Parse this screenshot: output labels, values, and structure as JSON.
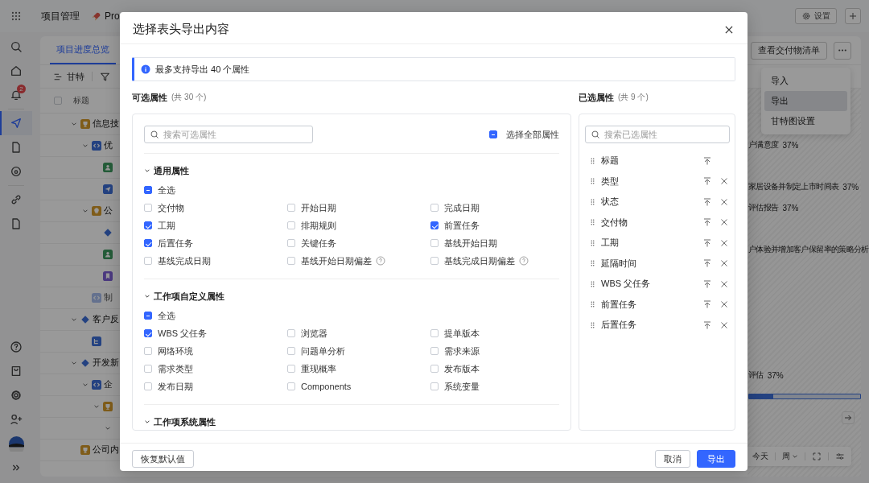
{
  "app": {
    "title": "项目管理",
    "project": "Pro",
    "settings": "设置",
    "sidebar_top": [
      {
        "kind": "search",
        "selected": false
      },
      {
        "kind": "home",
        "selected": false
      },
      {
        "kind": "bell",
        "selected": false,
        "badge": "2"
      },
      {
        "kind": "send",
        "selected": true
      },
      {
        "kind": "file",
        "selected": false
      },
      {
        "kind": "target",
        "selected": false
      },
      {
        "kind": "link",
        "selected": false
      },
      {
        "kind": "file",
        "selected": false
      }
    ],
    "sidebar_bottom": [
      {
        "kind": "help",
        "selected": false
      },
      {
        "kind": "bag",
        "selected": false
      },
      {
        "kind": "gear",
        "selected": false
      },
      {
        "kind": "user-add",
        "selected": false
      },
      {
        "kind": "avatar",
        "selected": false
      },
      {
        "kind": "expand",
        "selected": false
      }
    ],
    "view_tab": "项目进度总览",
    "toolbar_label": "甘特",
    "column_title": "标题",
    "column_checked": false,
    "deliverables_button": "查看交付物清单",
    "menu": [
      {
        "label": "导入",
        "hovered": false
      },
      {
        "label": "导出",
        "hovered": true
      },
      {
        "label": "甘特图设置",
        "hovered": false
      }
    ],
    "tree": [
      {
        "label": "信息技",
        "kind": "goal",
        "children": [
          {
            "label": "优",
            "kind": "code",
            "gantt_label": "户满意度",
            "gantt_percent": "37%",
            "children": [
              {
                "kind": "user"
              },
              {
                "kind": "send",
                "gantt_label": "家居设备并制定上市时间表",
                "gantt_percent": "37%"
              }
            ]
          },
          {
            "label": "公",
            "kind": "idea",
            "gantt_label": "评估报告",
            "gantt_percent": "37%",
            "children": [
              {
                "kind": "diamond"
              },
              {
                "kind": "user",
                "gantt_label": "户体验并增加客户保留率的策略分析"
              },
              {
                "kind": "bookmark"
              }
            ]
          },
          {
            "label": "制",
            "kind": "code",
            "muted": true
          }
        ]
      },
      {
        "label": "客户反",
        "kind": "diamond",
        "children": [
          {
            "kind": "subtask"
          }
        ]
      },
      {
        "label": "开发新",
        "kind": "diamond",
        "children": [
          {
            "label": "企",
            "kind": "code",
            "gantt_label": "评估",
            "gantt_percent": "37%",
            "children": [
              {
                "kind": "goal",
                "level": 0.22,
                "children": [
                  {
                    "expandable": true
                  }
                ]
              }
            ]
          }
        ]
      },
      {
        "label": "公司内",
        "kind": "goal"
      }
    ],
    "bottom_tools": {
      "today": "今天",
      "scale": "周"
    }
  },
  "dialog": {
    "title": "选择表头导出内容",
    "info": "最多支持导出 40 个属性",
    "available": {
      "label": "可选属性",
      "count": "(共 30 个)",
      "search_placeholder": "搜索可选属性",
      "select_all": {
        "label": "选择全部属性",
        "indeterminate": true
      },
      "groups": [
        {
          "name": "通用属性",
          "all": {
            "label": "全选",
            "indeterminate": true
          },
          "items": [
            {
              "label": "交付物",
              "checked": false
            },
            {
              "label": "开始日期",
              "checked": false
            },
            {
              "label": "完成日期",
              "checked": false
            },
            {
              "label": "工期",
              "checked": true
            },
            {
              "label": "排期规则",
              "checked": false
            },
            {
              "label": "前置任务",
              "checked": true
            },
            {
              "label": "后置任务",
              "checked": true
            },
            {
              "label": "关键任务",
              "checked": false
            },
            {
              "label": "基线开始日期",
              "checked": false
            },
            {
              "label": "基线完成日期",
              "checked": false
            },
            {
              "label": "基线开始日期偏差",
              "checked": false,
              "help": true
            },
            {
              "label": "基线完成日期偏差",
              "checked": false,
              "help": true
            }
          ]
        },
        {
          "name": "工作项自定义属性",
          "all": {
            "label": "全选",
            "indeterminate": true
          },
          "items": [
            {
              "label": "WBS 父任务",
              "checked": true
            },
            {
              "label": "浏览器",
              "checked": false
            },
            {
              "label": "提单版本",
              "checked": false
            },
            {
              "label": "网络环境",
              "checked": false
            },
            {
              "label": "问题单分析",
              "checked": false
            },
            {
              "label": "需求来源",
              "checked": false
            },
            {
              "label": "需求类型",
              "checked": false
            },
            {
              "label": "重现概率",
              "checked": false
            },
            {
              "label": "发布版本",
              "checked": false
            },
            {
              "label": "发布日期",
              "checked": false
            },
            {
              "label": "Components",
              "checked": false
            },
            {
              "label": "系统变量",
              "checked": false
            }
          ]
        },
        {
          "name": "工作项系统属性"
        }
      ]
    },
    "selected": {
      "label": "已选属性",
      "count": "(共 9 个)",
      "search_placeholder": "搜索已选属性",
      "items": [
        {
          "label": "标题",
          "removable": false
        },
        {
          "label": "类型",
          "removable": true
        },
        {
          "label": "状态",
          "removable": true
        },
        {
          "label": "交付物",
          "removable": true
        },
        {
          "label": "工期",
          "removable": true
        },
        {
          "label": "延隔时间",
          "removable": true
        },
        {
          "label": "WBS 父任务",
          "removable": true
        },
        {
          "label": "前置任务",
          "removable": true
        },
        {
          "label": "后置任务",
          "removable": true
        }
      ]
    },
    "buttons": {
      "reset": "恢复默认值",
      "cancel": "取消",
      "export": "导出"
    }
  }
}
